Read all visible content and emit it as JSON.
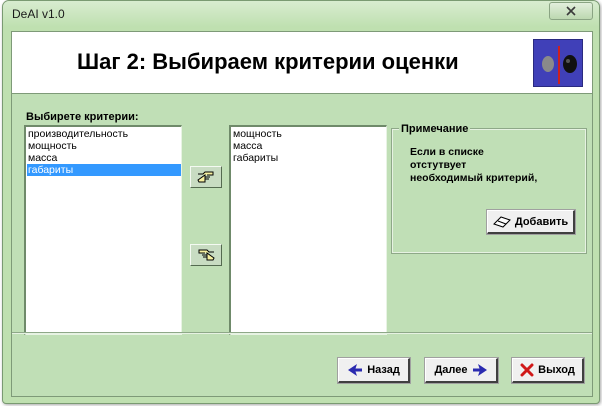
{
  "window": {
    "title": "DeAI v1.0",
    "close_glyph": "✕"
  },
  "header": {
    "title": "Шаг 2: Выбираем критерии оценки",
    "logo_icon": "scales-logo-icon"
  },
  "criteria": {
    "label": "Выбирете критерии:",
    "available": [
      {
        "label": "производительность",
        "selected": false
      },
      {
        "label": "мощность",
        "selected": false
      },
      {
        "label": "масса",
        "selected": false
      },
      {
        "label": "габариты",
        "selected": true
      }
    ],
    "chosen": [
      {
        "label": "мощность"
      },
      {
        "label": "масса"
      },
      {
        "label": "габариты"
      }
    ]
  },
  "transfer": {
    "add_icon": "hand-pointing-right-icon",
    "remove_icon": "hand-pointing-left-icon"
  },
  "note": {
    "title": "Примечание",
    "lines": [
      "Если в списке",
      "отстутвует",
      "необходимый критерий,"
    ],
    "add_button_label": "Добавить",
    "add_button_icon": "eraser-icon"
  },
  "footer": {
    "back_label": "Назад",
    "next_label": "Далее",
    "exit_label": "Выход"
  },
  "colors": {
    "window_bg": "#c0dfb6",
    "selection": "#3399ff",
    "logo_bg": "#4040b8",
    "arrow_blue": "#2a2ab0",
    "exit_red": "#d01818"
  }
}
